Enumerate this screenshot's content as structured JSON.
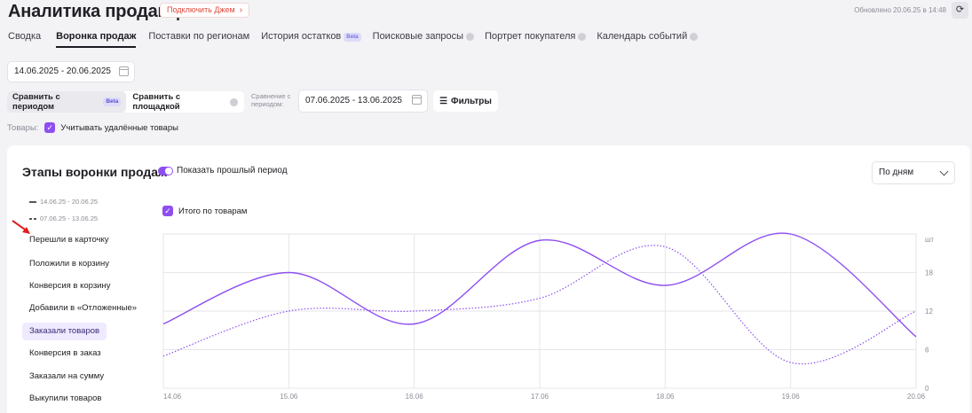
{
  "header": {
    "title": "Аналитика продавца",
    "connect_label": "Подключить Джем",
    "updated": "Обновлено 20.06.25 в 14:48"
  },
  "tabs": [
    {
      "label": "Сводка",
      "active": false
    },
    {
      "label": "Воронка продаж",
      "active": true
    },
    {
      "label": "Поставки по регионам",
      "active": false
    },
    {
      "label": "История остатков",
      "active": false,
      "badge": "Beta"
    },
    {
      "label": "Поисковые запросы",
      "active": false,
      "locked": true
    },
    {
      "label": "Портрет покупателя",
      "active": false,
      "locked": true
    },
    {
      "label": "Календарь событий",
      "active": false,
      "locked": true
    }
  ],
  "period": {
    "value": "14.06.2025 - 20.06.2025"
  },
  "compare": {
    "period_label": "Сравнить с периодом",
    "period_badge": "Beta",
    "platform_label": "Сравнить с площадкой",
    "cmp_label": "Сравнение с периодом:",
    "cmp_value": "07.06.2025 - 13.06.2025",
    "filters_label": "Фильтры"
  },
  "goods": {
    "label": "Товары:",
    "checkbox_label": "Учитывать удалённые товары"
  },
  "panel": {
    "title": "Этапы воронки продаж",
    "toggle_label": "Показать прошлый период",
    "select_value": "По дням",
    "legend": [
      "14.06.25 - 20.06.25",
      "07.06.25 - 13.06.25"
    ],
    "total_label": "Итого по товарам",
    "metrics": [
      {
        "label": "Перешли в карточку",
        "selected": false
      },
      {
        "label": "Положили в корзину",
        "selected": false
      },
      {
        "label": "Конверсия в корзину",
        "selected": false
      },
      {
        "label": "Добавили в «Отложенные»",
        "selected": false
      },
      {
        "label": "Заказали товаров",
        "selected": true
      },
      {
        "label": "Конверсия в заказ",
        "selected": false
      },
      {
        "label": "Заказали на сумму",
        "selected": false
      },
      {
        "label": "Выкупили товаров",
        "selected": false
      }
    ]
  },
  "colors": {
    "accent": "#8f4ff0",
    "danger": "#e0483a"
  },
  "chart_data": {
    "type": "line",
    "x": [
      "14.06",
      "15.06",
      "16.06",
      "17.06",
      "18.06",
      "19.06",
      "20.06"
    ],
    "unit": "шт",
    "ylim": [
      0,
      24
    ],
    "yticks": [
      0,
      6,
      12,
      18
    ],
    "grid": true,
    "series": [
      {
        "name": "14.06.25 - 20.06.25",
        "style": "solid",
        "values": [
          10,
          18,
          10,
          23,
          16,
          24,
          8
        ]
      },
      {
        "name": "07.06.25 - 13.06.25",
        "style": "dotted",
        "values": [
          5,
          12,
          12,
          14,
          22,
          4,
          12
        ]
      }
    ]
  }
}
